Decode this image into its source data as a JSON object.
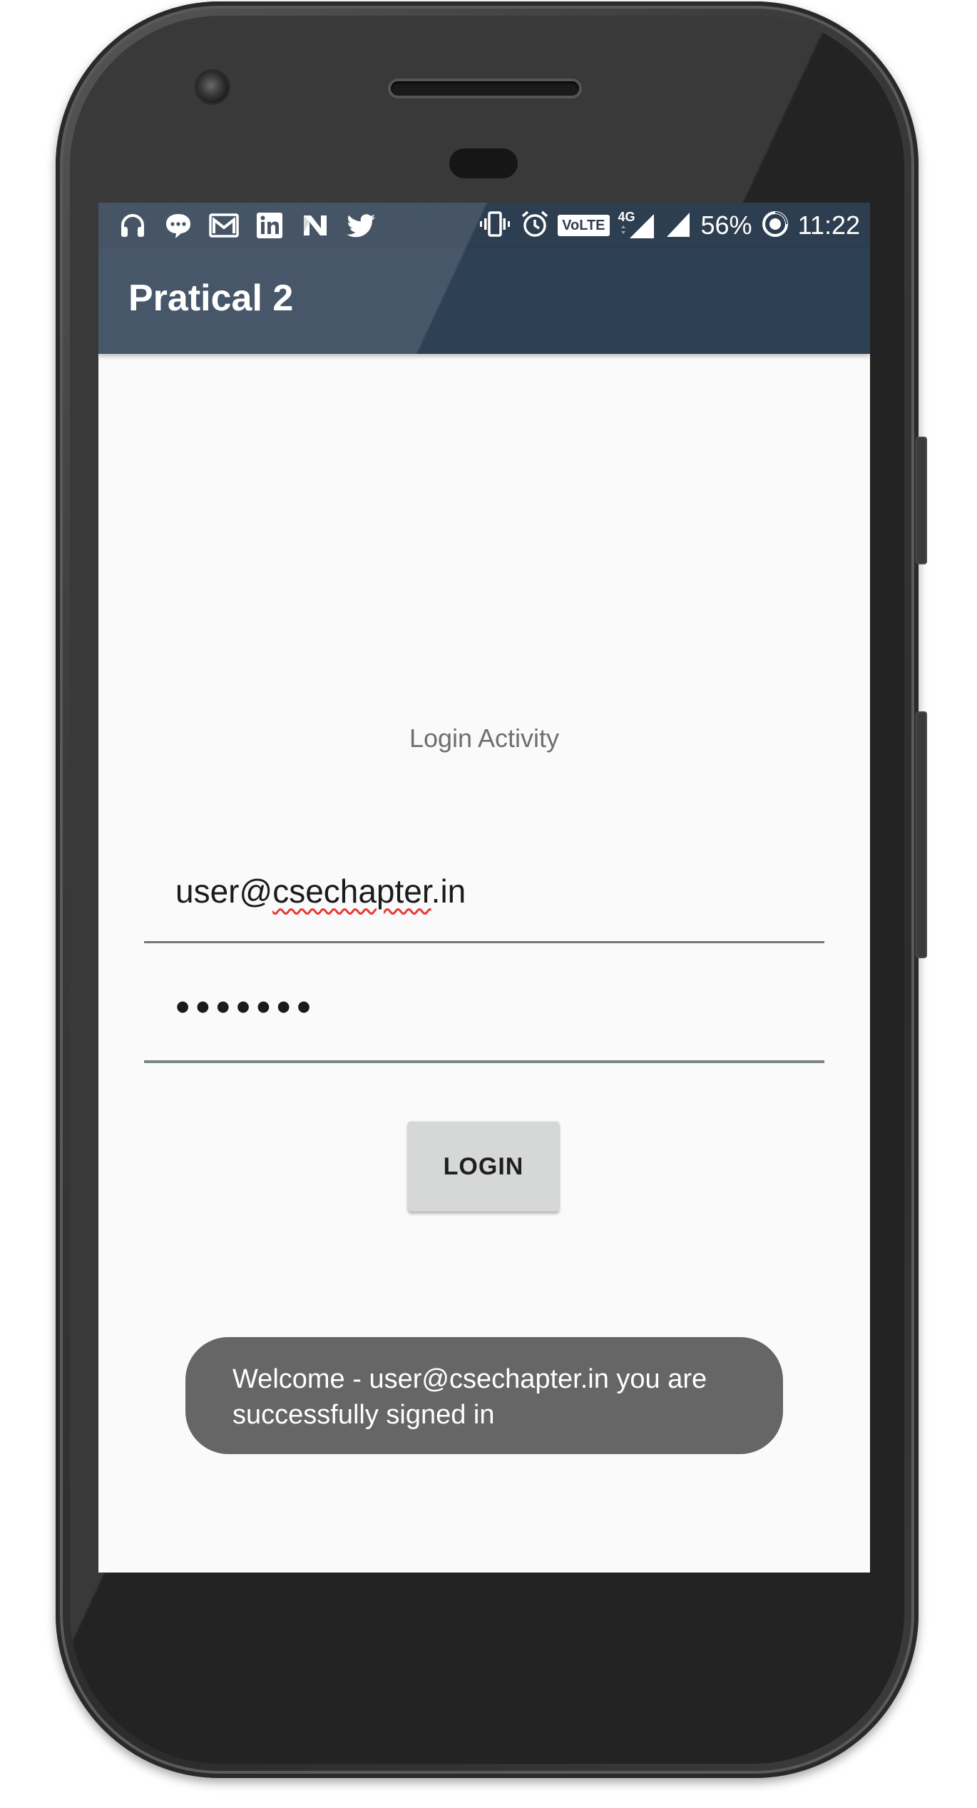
{
  "status_bar": {
    "battery": "56%",
    "time": "11:22",
    "network": "4G",
    "volte_badge": "VoLTE",
    "left_icons": [
      "headphones-icon",
      "chat-bubble-icon",
      "gmail-icon",
      "linkedin-icon",
      "n-icon",
      "twitter-icon"
    ],
    "right_icons": [
      "vibrate-icon",
      "alarm-icon",
      "volte-icon",
      "signal-4g-icon",
      "signal-icon",
      "battery-saver-icon"
    ]
  },
  "app_bar": {
    "title": "Pratical 2"
  },
  "content": {
    "activity_label": "Login Activity",
    "email_field": {
      "prefix": "user@",
      "misspelled": "csechapter",
      "suffix": ".in"
    },
    "password_field": {
      "masked_value": "•••••••"
    },
    "login_button": {
      "label": "LOGIN"
    }
  },
  "toast": {
    "message": "Welcome - user@csechapter.in you are successfully signed in"
  },
  "colors": {
    "app_bar": "#2e4054",
    "background": "#fafafa",
    "button": "#d6d7d7",
    "toast": "#666666",
    "spelling_underline": "#e53935"
  }
}
